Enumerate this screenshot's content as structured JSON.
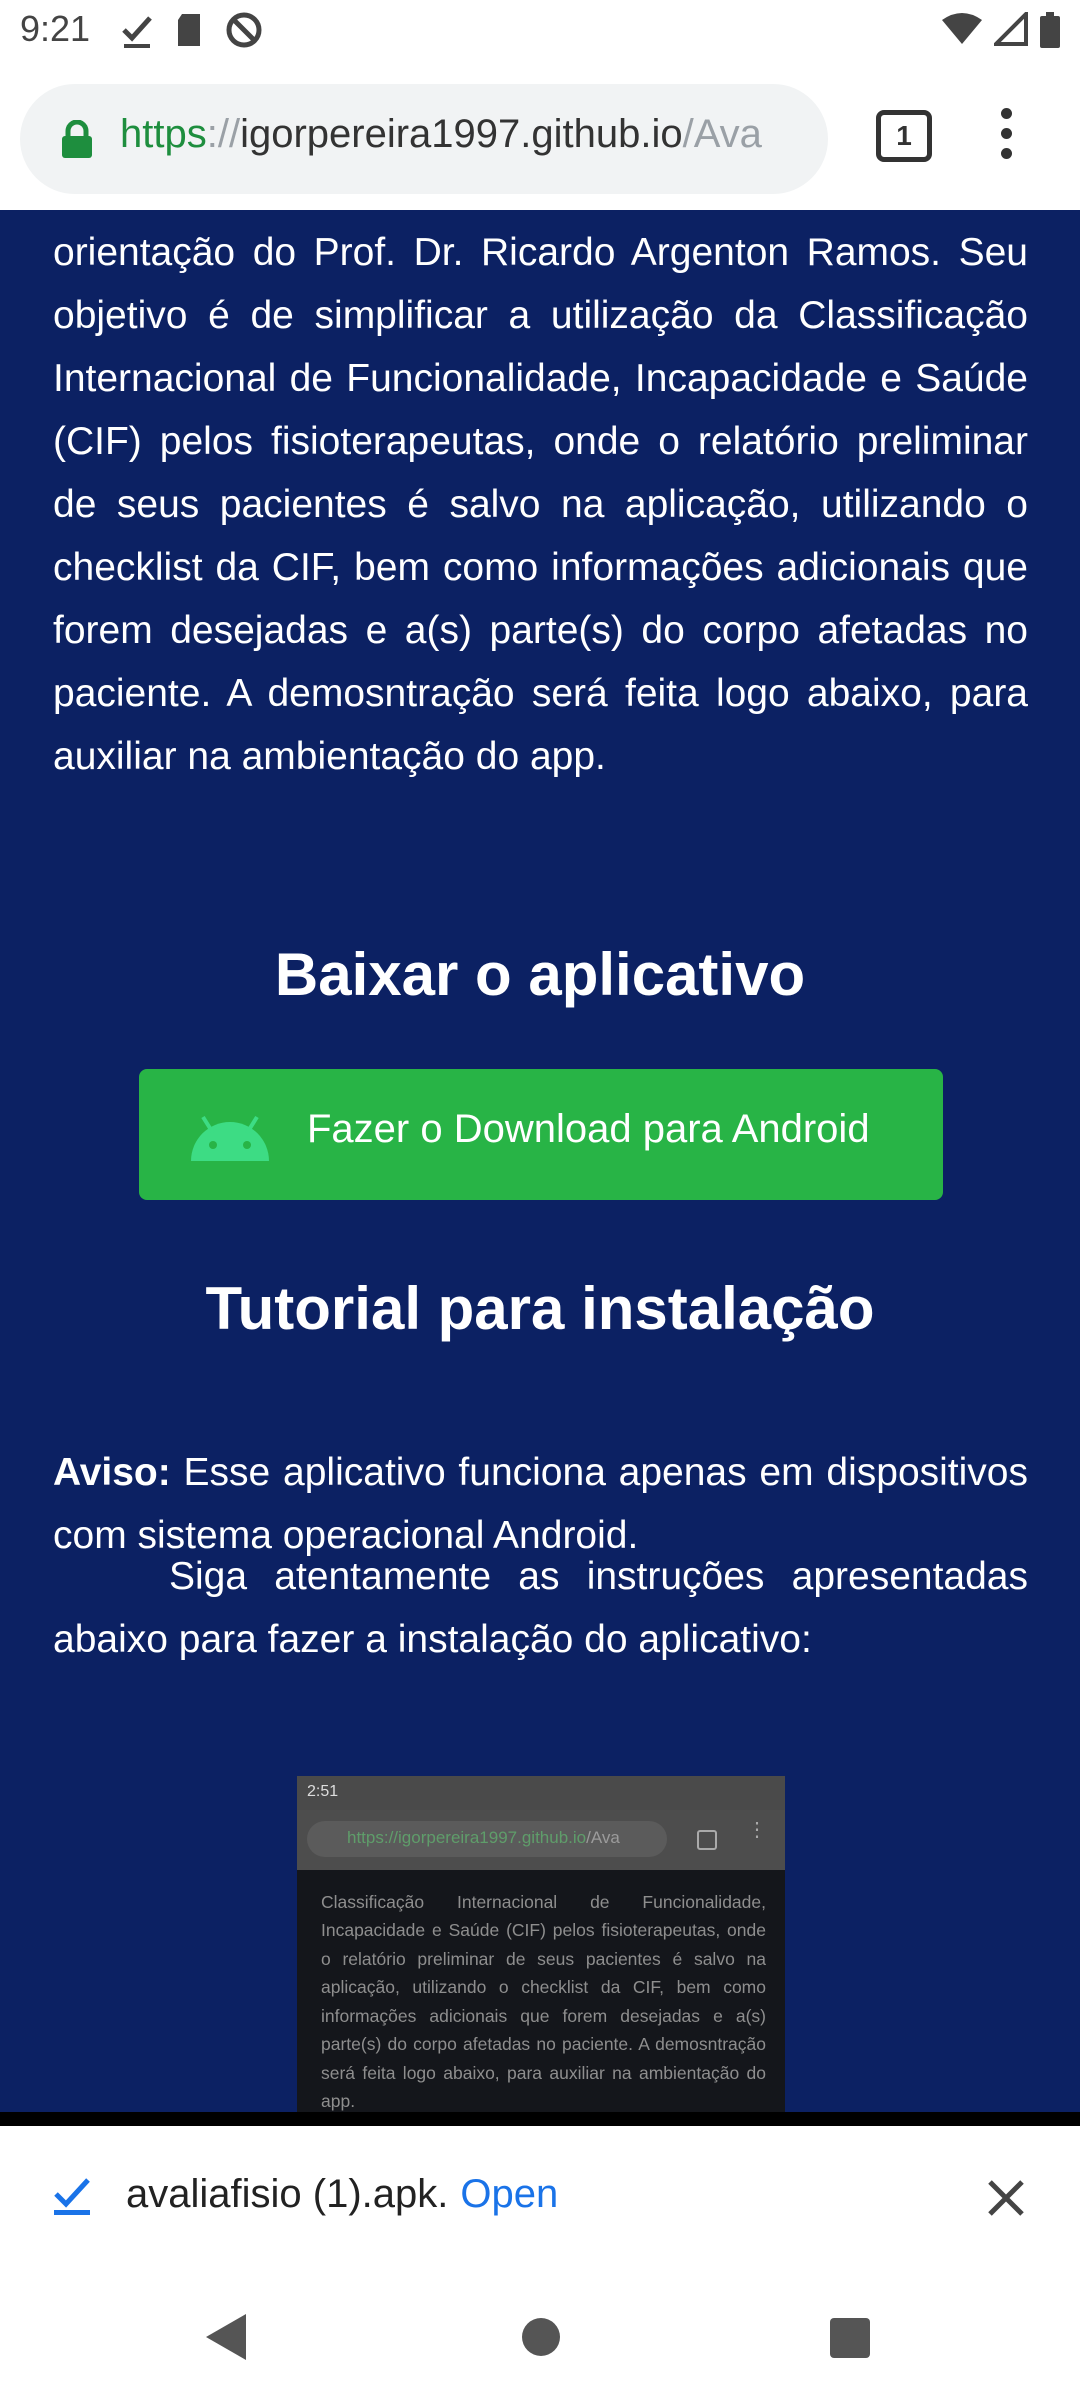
{
  "status_bar": {
    "time": "9:21",
    "left_icons": [
      "check-icon",
      "sd-card-icon",
      "sync-disabled-icon"
    ],
    "right_icons": [
      "wifi-icon",
      "signal-icon",
      "battery-icon"
    ]
  },
  "browser": {
    "url_scheme": "https",
    "url_sep": "://",
    "url_host": "igorpereira1997.github.io",
    "url_path": "/Ava",
    "tab_count": "1"
  },
  "page": {
    "intro": "orientação do Prof. Dr. Ricardo Argenton Ramos. Seu objetivo é de simplificar a utilização da Classificação Internacional de Funcionalidade, Incapacidade e Saúde (CIF) pelos fisioterapeutas, onde o relatório preliminar de seus pacientes é salvo na aplicação, utilizando o checklist da CIF, bem como informações adicionais que forem desejadas e a(s) parte(s) do corpo afetadas no paciente. A demosntração será feita logo abaixo, para auxiliar na ambientação do app.",
    "download_heading": "Baixar o aplicativo",
    "download_button": "Fazer o Download para Android",
    "tutorial_heading": "Tutorial para instalação",
    "warning_label": "Aviso:",
    "warning_text": " Esse aplicativo funciona apenas em dispositivos com sistema operacional Android.",
    "instructions": "Siga atentamente as instruções apresentadas abaixo para fazer a instalação do aplicativo:",
    "screenshot": {
      "time": "2:51",
      "url_scheme": "https://",
      "url_host": "igorpereira1997.github.io",
      "url_path": "/Ava",
      "text": "Classificação Internacional de Funcionalidade, Incapacidade e Saúde (CIF) pelos fisioterapeutas, onde o relatório preliminar de seus pacientes é salvo na aplicação, utilizando o checklist da CIF, bem como informações adicionais que forem desejadas e a(s) parte(s) do corpo afetadas no paciente. A demosntração será feita logo abaixo, para auxiliar na ambientação do app."
    }
  },
  "download_bar": {
    "filename": "avaliafisio (1).apk.",
    "open_label": "Open"
  },
  "colors": {
    "page_bg": "#0c2163",
    "download_button": "#28b446",
    "link_blue": "#1a73e8"
  }
}
